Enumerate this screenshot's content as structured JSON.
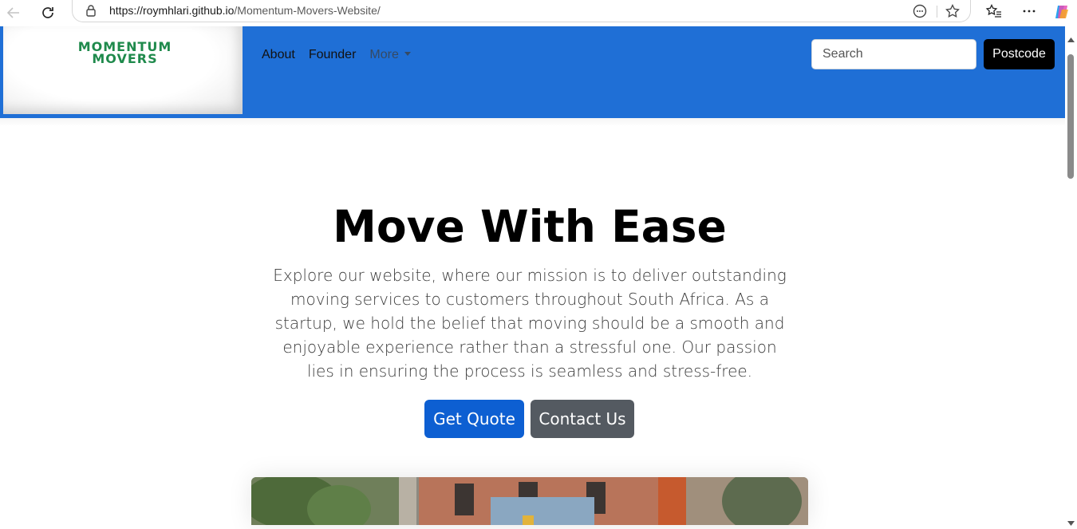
{
  "browser": {
    "url_host": "https://roymhlari.github.io",
    "url_path": "/Momentum-Movers-Website/"
  },
  "site": {
    "logo": {
      "line1": "MOMENTUM",
      "line2": "MOVERS"
    },
    "nav": {
      "items": [
        {
          "label": "About"
        },
        {
          "label": "Founder"
        },
        {
          "label": "More"
        }
      ]
    },
    "search": {
      "placeholder": "Search"
    },
    "postcode_label": "Postcode"
  },
  "hero": {
    "title": "Move With Ease",
    "description": "Explore our website, where our mission is to deliver outstanding moving services to customers throughout South Africa. As a startup, we hold the belief that moving should be a smooth and enjoyable experience rather than a stressful one. Our passion lies in ensuring the process is seamless and stress-free.",
    "primary_button": "Get Quote",
    "secondary_button": "Contact Us"
  },
  "colors": {
    "navbar": "#1f6fd6",
    "primary_button": "#0d5fd2",
    "secondary_button": "#545a61",
    "logo_green": "#1f8a4c"
  }
}
